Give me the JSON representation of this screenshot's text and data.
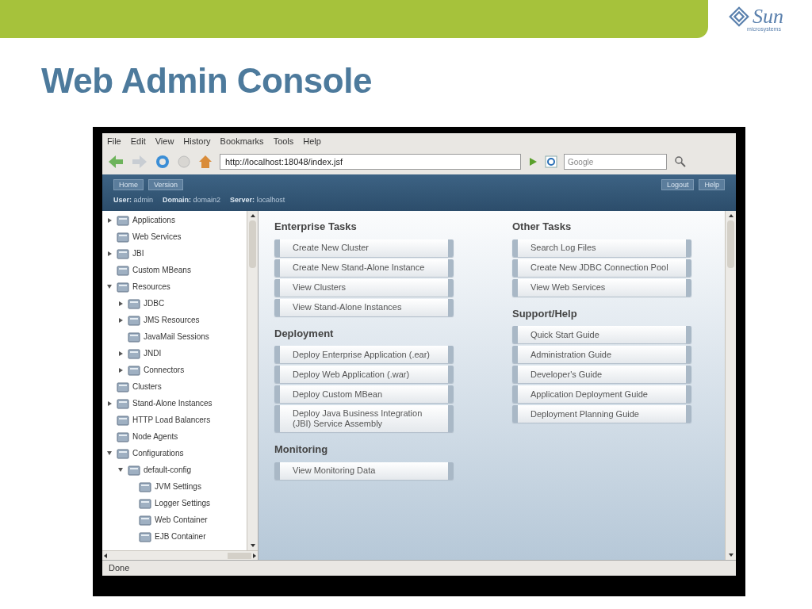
{
  "slide": {
    "title": "Web Admin Console",
    "logo": {
      "name": "Sun",
      "tagline": "microsystems"
    }
  },
  "browser": {
    "menu": [
      "File",
      "Edit",
      "View",
      "History",
      "Bookmarks",
      "Tools",
      "Help"
    ],
    "url": "http://localhost:18048/index.jsf",
    "search": {
      "placeholder": "Google"
    },
    "status": "Done"
  },
  "header": {
    "left_buttons": [
      "Home",
      "Version"
    ],
    "right_buttons": [
      "Logout",
      "Help"
    ],
    "info": [
      {
        "label": "User:",
        "value": "admin"
      },
      {
        "label": "Domain:",
        "value": "domain2"
      },
      {
        "label": "Server:",
        "value": "localhost"
      }
    ]
  },
  "tree": [
    {
      "label": "Applications",
      "expanded": false
    },
    {
      "label": "Web Services"
    },
    {
      "label": "JBI",
      "expanded": false
    },
    {
      "label": "Custom MBeans"
    },
    {
      "label": "Resources",
      "expanded": true,
      "children": [
        {
          "label": "JDBC",
          "expanded": false
        },
        {
          "label": "JMS Resources",
          "expanded": false
        },
        {
          "label": "JavaMail Sessions"
        },
        {
          "label": "JNDI",
          "expanded": false
        },
        {
          "label": "Connectors",
          "expanded": false
        }
      ]
    },
    {
      "label": "Clusters"
    },
    {
      "label": "Stand-Alone Instances",
      "expanded": false
    },
    {
      "label": "HTTP Load Balancers"
    },
    {
      "label": "Node Agents"
    },
    {
      "label": "Configurations",
      "expanded": true,
      "children": [
        {
          "label": "default-config",
          "expanded": true,
          "children": [
            {
              "label": "JVM Settings"
            },
            {
              "label": "Logger Settings"
            },
            {
              "label": "Web Container"
            },
            {
              "label": "EJB Container"
            }
          ]
        }
      ]
    }
  ],
  "columns": [
    [
      {
        "title": "Enterprise Tasks",
        "tasks": [
          "Create New Cluster",
          "Create New Stand-Alone Instance",
          "View Clusters",
          "View Stand-Alone Instances"
        ]
      },
      {
        "title": "Deployment",
        "tasks": [
          "Deploy Enterprise Application (.ear)",
          "Deploy Web Application (.war)",
          "Deploy Custom MBean",
          "Deploy Java Business Integration (JBI) Service Assembly"
        ]
      },
      {
        "title": "Monitoring",
        "tasks": [
          "View Monitoring Data"
        ]
      }
    ],
    [
      {
        "title": "Other Tasks",
        "tasks": [
          "Search Log Files",
          "Create New JDBC Connection Pool",
          "View Web Services"
        ]
      },
      {
        "title": "Support/Help",
        "tasks": [
          "Quick Start Guide",
          "Administration Guide",
          "Developer's Guide",
          "Application Deployment Guide",
          "Deployment Planning Guide"
        ]
      }
    ]
  ]
}
